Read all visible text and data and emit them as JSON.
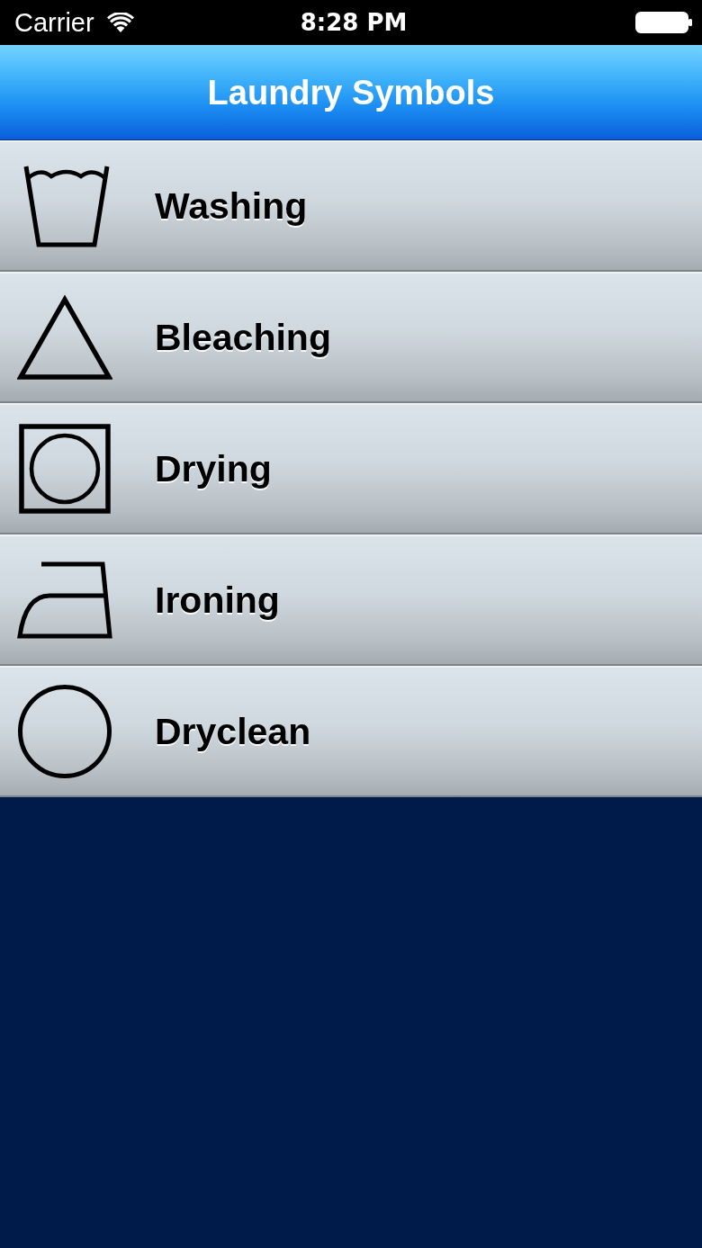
{
  "status_bar": {
    "carrier": "Carrier",
    "time": "8:28 PM"
  },
  "nav_bar": {
    "title": "Laundry Symbols"
  },
  "categories": [
    {
      "label": "Washing",
      "kind": "wash"
    },
    {
      "label": "Bleaching",
      "kind": "bleach"
    },
    {
      "label": "Drying",
      "kind": "dry"
    },
    {
      "label": "Ironing",
      "kind": "iron"
    },
    {
      "label": "Dryclean",
      "kind": "dryclean"
    }
  ]
}
